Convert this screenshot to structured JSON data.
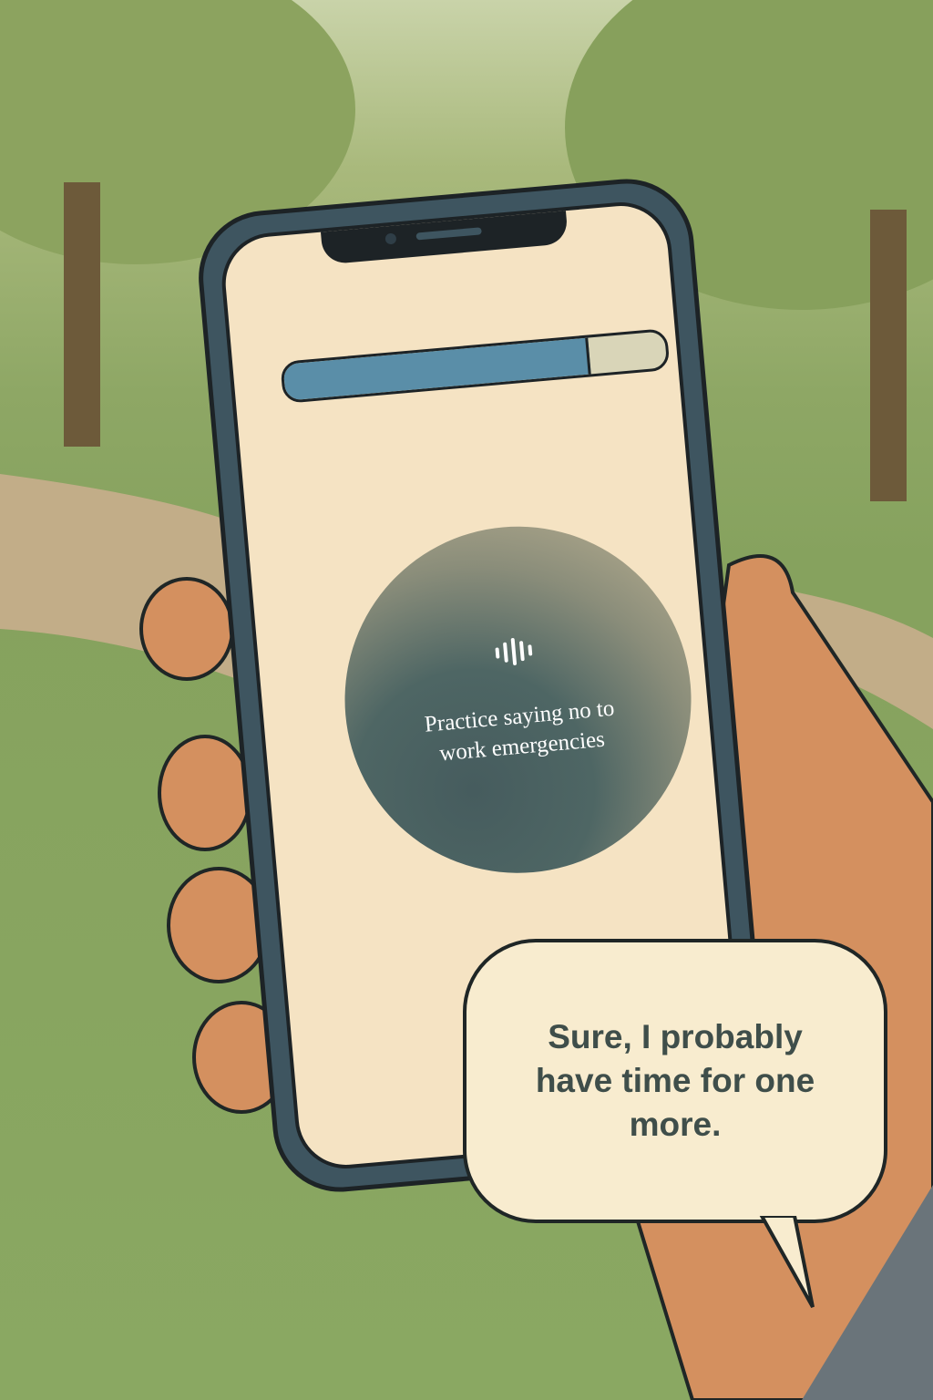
{
  "app": {
    "progress": {
      "value_percent": 80,
      "fill_color": "#5a8ea8",
      "track_color": "#d9d5b8"
    },
    "prompt_orb": {
      "icon": "audio-waveform-icon",
      "text": "Practice saying no to work emergencies"
    }
  },
  "speech_bubble": {
    "text": "Sure, I probably have time for one more."
  }
}
